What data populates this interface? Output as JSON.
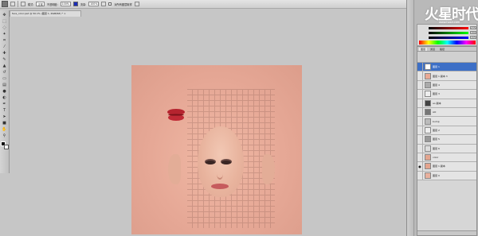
{
  "options_bar": {
    "mode_label": "模式:",
    "mode_value": "正常",
    "opacity_label": "不透明度:",
    "opacity_value": "100%",
    "flow_label": "流量:",
    "flow_value": "100%",
    "sample_label": "对所有图层取样"
  },
  "document": {
    "tab_title": "face_color.psd @ 50.1% (图层 1, RGB/8#) * ×"
  },
  "watermark": {
    "brand": "火星时代",
    "url": "www.hxsd.com"
  },
  "color_panel": {
    "values": [
      "235",
      "180",
      "165"
    ]
  },
  "layers_panel": {
    "tabs": [
      "图层",
      "通道",
      "路径"
    ],
    "layers": [
      {
        "name": "图层 1",
        "selected": true,
        "visible": false,
        "thumb": "#ffffff"
      },
      {
        "name": "图层 1 副本 3",
        "selected": false,
        "visible": false,
        "thumb": "#e9a994"
      },
      {
        "name": "图层 4",
        "selected": false,
        "visible": false,
        "thumb": "#aaaaaa"
      },
      {
        "name": "图层 3",
        "selected": false,
        "visible": false,
        "thumb": "#eeeeee"
      },
      {
        "name": "ao 副本",
        "selected": false,
        "visible": false,
        "thumb": "#444444"
      },
      {
        "name": "AO",
        "selected": false,
        "visible": false,
        "thumb": "#777777"
      },
      {
        "name": "bump",
        "selected": false,
        "visible": false,
        "thumb": "#bbbbbb"
      },
      {
        "name": "图层 2",
        "selected": false,
        "visible": false,
        "thumb": "#eeeeee"
      },
      {
        "name": "图层 5",
        "selected": false,
        "visible": false,
        "thumb": "#999999"
      },
      {
        "name": "图层 6",
        "selected": false,
        "visible": false,
        "thumb": "#dddddd"
      },
      {
        "name": "color",
        "selected": false,
        "visible": false,
        "thumb": "#e3a58f"
      },
      {
        "name": "图层 1 副本",
        "selected": false,
        "visible": true,
        "thumb": "#e4a48e"
      },
      {
        "name": "图层 0",
        "selected": false,
        "visible": false,
        "thumb": "#e8b09d"
      }
    ]
  },
  "tools": [
    "move",
    "marquee",
    "lasso",
    "magic-wand",
    "crop",
    "eyedropper",
    "healing",
    "brush",
    "clone-stamp",
    "history-brush",
    "eraser",
    "gradient",
    "blur",
    "dodge",
    "pen",
    "type",
    "path-select",
    "shape",
    "hand",
    "zoom"
  ]
}
